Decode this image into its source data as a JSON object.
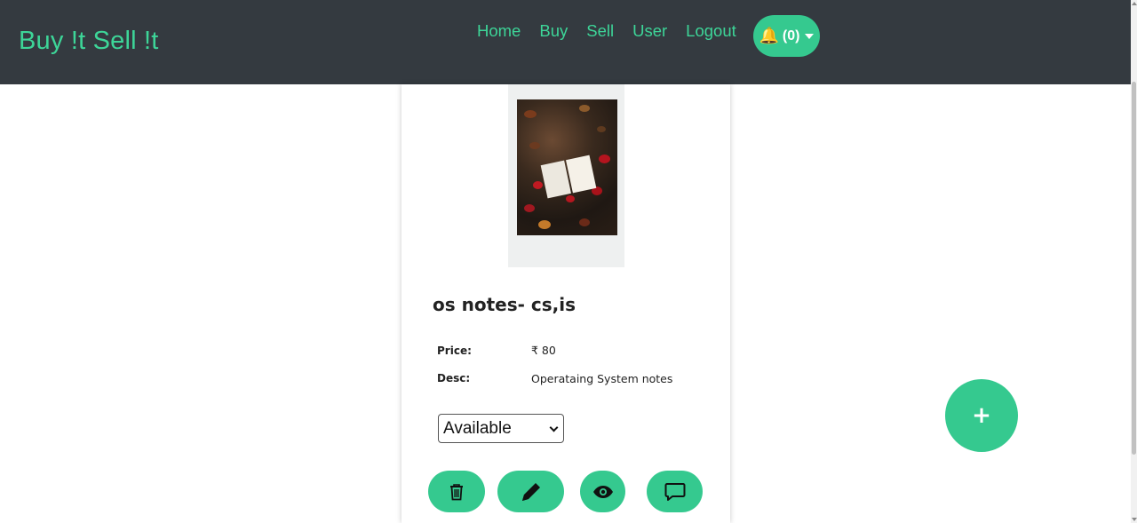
{
  "navbar": {
    "brand": "Buy !t Sell !t",
    "links": [
      "Home",
      "Buy",
      "Sell",
      "User",
      "Logout"
    ],
    "notifications": {
      "icon": "bell-icon",
      "count_label": "(0)"
    }
  },
  "product": {
    "title": "os notes- cs,is",
    "price_label": "Price:",
    "price_value": "₹ 80",
    "desc_label": "Desc:",
    "desc_value": "Operataing System notes",
    "status": {
      "selected": "Available"
    },
    "actions": [
      "trash-icon",
      "pencil-icon",
      "eye-icon",
      "chat-icon"
    ]
  },
  "fab": {
    "label": "+"
  },
  "colors": {
    "navbar_bg": "#343a40",
    "accent": "#35c98f",
    "brand_text": "#3dd598"
  }
}
